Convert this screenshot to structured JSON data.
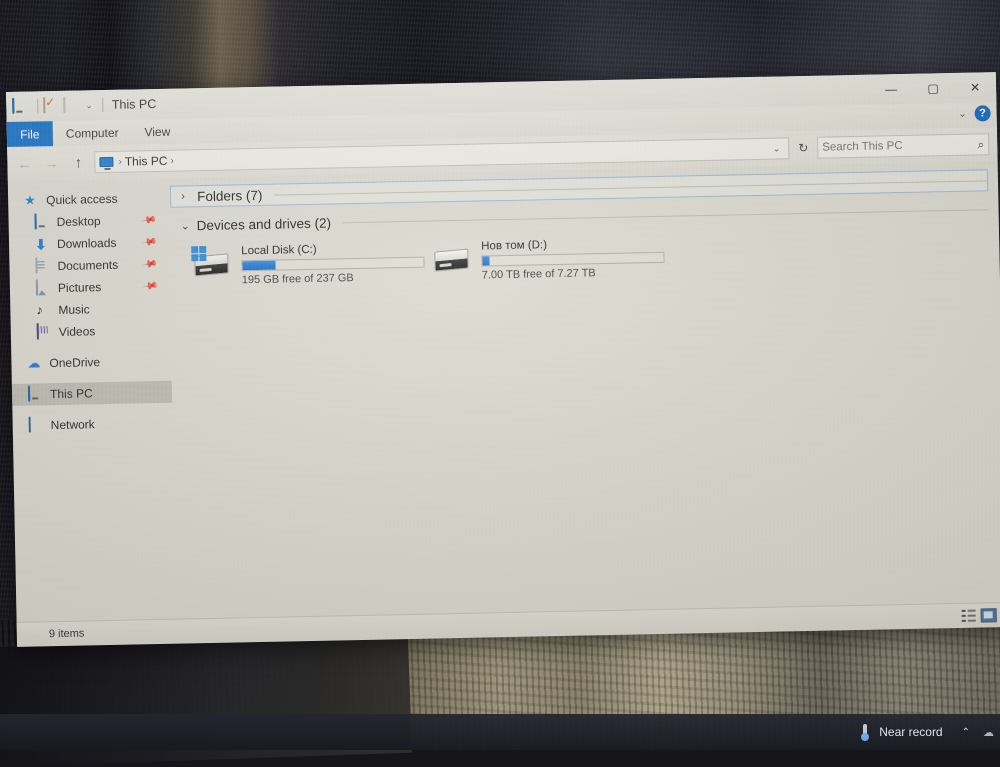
{
  "window": {
    "title": "This PC",
    "quick_access_icons": [
      "monitor-icon",
      "properties-icon",
      "new-folder-icon"
    ],
    "caret": "▾",
    "controls": {
      "minimize": "—",
      "maximize": "▢",
      "close": "✕",
      "ribbon_chevron": "⌄",
      "help": "?"
    }
  },
  "ribbon": {
    "file_tab": "File",
    "tabs": [
      {
        "label": "Computer"
      },
      {
        "label": "View"
      }
    ]
  },
  "address_bar": {
    "back": "←",
    "forward": "→",
    "up": "↑",
    "breadcrumb": [
      {
        "label": "This PC",
        "icon": "this-pc-icon"
      }
    ],
    "separator": "›",
    "history_caret": "⌄",
    "refresh": "↻",
    "search_placeholder": "Search This PC",
    "search_value": "",
    "search_icon": "⌕"
  },
  "sidebar": {
    "items": [
      {
        "label": "Quick access",
        "icon": "star-icon",
        "pinned": false,
        "indent": false,
        "selected": false
      },
      {
        "label": "Desktop",
        "icon": "desktop-icon",
        "pinned": true,
        "indent": true,
        "selected": false
      },
      {
        "label": "Downloads",
        "icon": "download-icon",
        "pinned": true,
        "indent": true,
        "selected": false
      },
      {
        "label": "Documents",
        "icon": "document-icon",
        "pinned": true,
        "indent": true,
        "selected": false
      },
      {
        "label": "Pictures",
        "icon": "picture-icon",
        "pinned": true,
        "indent": true,
        "selected": false
      },
      {
        "label": "Music",
        "icon": "music-icon",
        "pinned": false,
        "indent": true,
        "selected": false
      },
      {
        "label": "Videos",
        "icon": "video-icon",
        "pinned": false,
        "indent": true,
        "selected": false
      },
      {
        "label": "OneDrive",
        "icon": "cloud-icon",
        "pinned": false,
        "indent": false,
        "selected": false
      },
      {
        "label": "This PC",
        "icon": "this-pc-icon",
        "pinned": false,
        "indent": false,
        "selected": true
      },
      {
        "label": "Network",
        "icon": "network-icon",
        "pinned": false,
        "indent": false,
        "selected": false
      }
    ],
    "pin_glyph": "📌"
  },
  "content": {
    "groups": [
      {
        "label": "Folders (7)",
        "chevron": "›",
        "expanded": false,
        "focused": true
      },
      {
        "label": "Devices and drives (2)",
        "chevron": "⌄",
        "expanded": true,
        "focused": false
      }
    ],
    "drives": [
      {
        "name": "Local Disk (C:)",
        "free_text": "195 GB free of 237 GB",
        "used_percent": 18,
        "icon": "hard-drive-windows-icon"
      },
      {
        "name": "Нов том (D:)",
        "free_text": "7.00 TB free of 7.27 TB",
        "used_percent": 4,
        "icon": "hard-drive-icon"
      }
    ]
  },
  "status_bar": {
    "item_count": "9 items",
    "view_details": "details-view-icon",
    "view_tiles": "large-icons-view-icon"
  },
  "taskbar": {
    "weather_label": "Near record",
    "weather_icon": "thermometer-icon",
    "overflow_chevron": "⌃",
    "tray_extra": "☁"
  },
  "colors": {
    "accent": "#1565c0",
    "progress_fill": "#1667c0",
    "window_bg": "#d8d6cc",
    "taskbar_bg": "#242630"
  }
}
